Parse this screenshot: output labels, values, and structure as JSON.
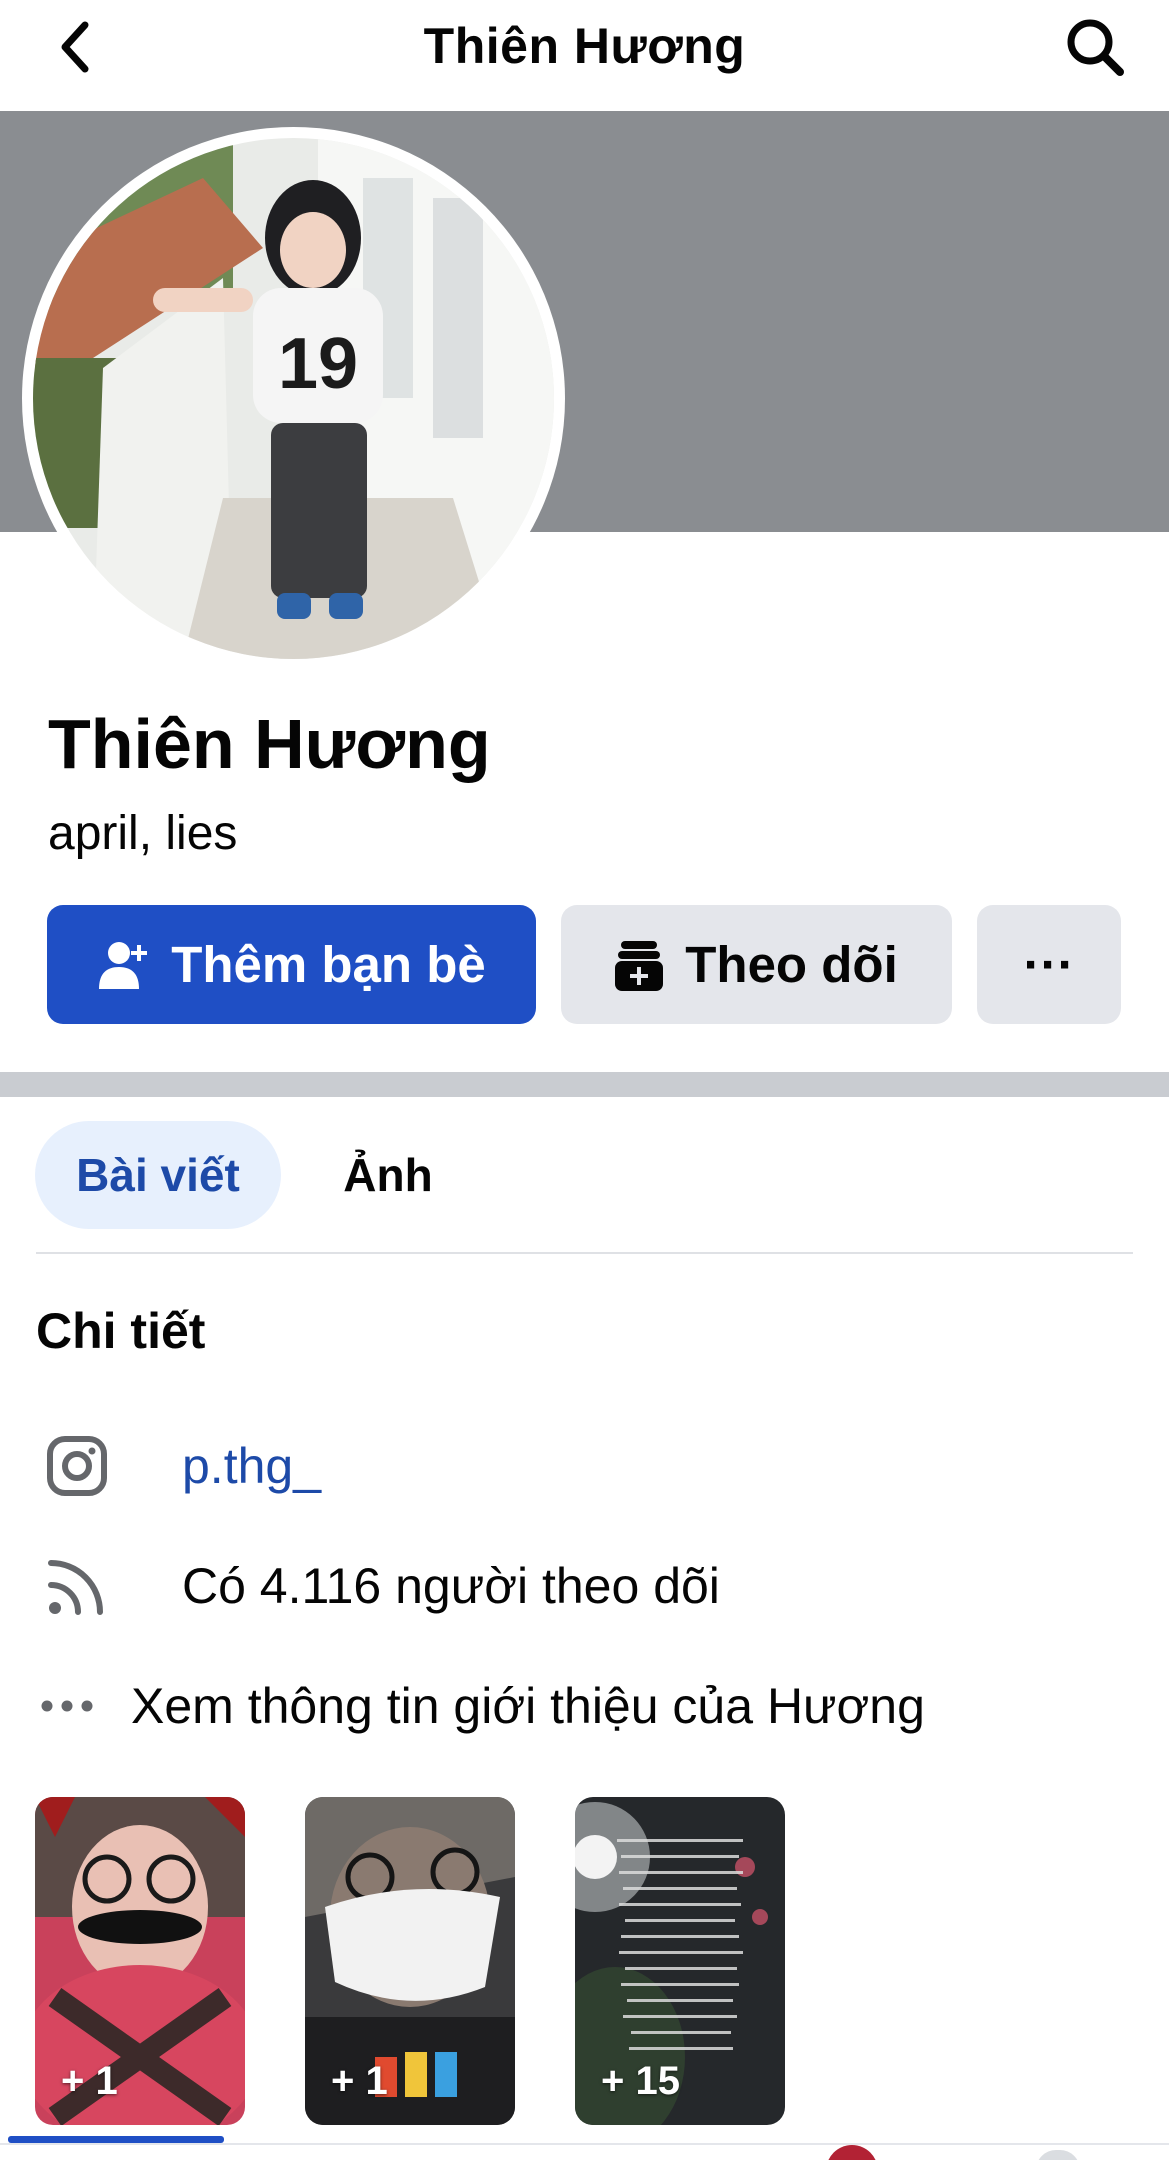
{
  "header": {
    "title": "Thiên Hương",
    "back_icon": "chevron-left-icon",
    "search_icon": "search-icon"
  },
  "profile": {
    "name": "Thiên Hương",
    "bio": "april, lies"
  },
  "actions": {
    "add_friend_label": "Thêm bạn bè",
    "add_friend_icon": "person-add-icon",
    "follow_label": "Theo dõi",
    "follow_icon": "follow-icon",
    "more_label": "···",
    "accent_color": "#1f4fc5"
  },
  "tabs": [
    {
      "label": "Bài viết",
      "active": true
    },
    {
      "label": "Ảnh",
      "active": false
    }
  ],
  "details": {
    "title": "Chi tiết",
    "instagram": "p.thg_",
    "followers": "Có 4.116 người theo dõi",
    "about": "Xem thông tin giới thiệu của Hương"
  },
  "highlights": [
    {
      "count": "+ 1"
    },
    {
      "count": "+ 1"
    },
    {
      "count": "+ 15"
    }
  ]
}
